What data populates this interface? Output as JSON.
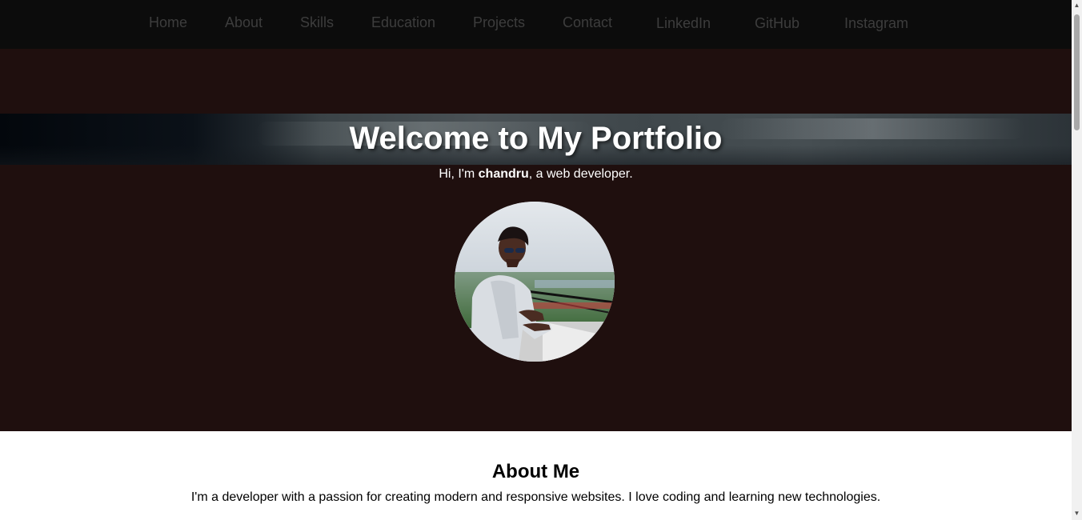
{
  "nav": {
    "items": [
      {
        "label": "Home"
      },
      {
        "label": "About"
      },
      {
        "label": "Skills"
      },
      {
        "label": "Education"
      },
      {
        "label": "Projects"
      },
      {
        "label": "Contact"
      },
      {
        "label": "LinkedIn"
      },
      {
        "label": "GitHub"
      },
      {
        "label": "Instagram"
      }
    ]
  },
  "hero": {
    "title": "Welcome to My Portfolio",
    "greeting_prefix": "Hi, I'm ",
    "name": "chandru",
    "greeting_suffix": ", a web developer."
  },
  "about": {
    "heading": "About Me",
    "text": "I'm a developer with a passion for creating modern and responsive websites. I love coding and learning new technologies."
  },
  "colors": {
    "nav_bg": "#0c0c0c",
    "nav_link": "#3d3d3d",
    "hero_bg": "#1f0f0e",
    "about_bg": "#ffffff"
  },
  "icons": {
    "scroll_up": "triangle-up-icon",
    "scroll_down": "triangle-down-icon"
  }
}
